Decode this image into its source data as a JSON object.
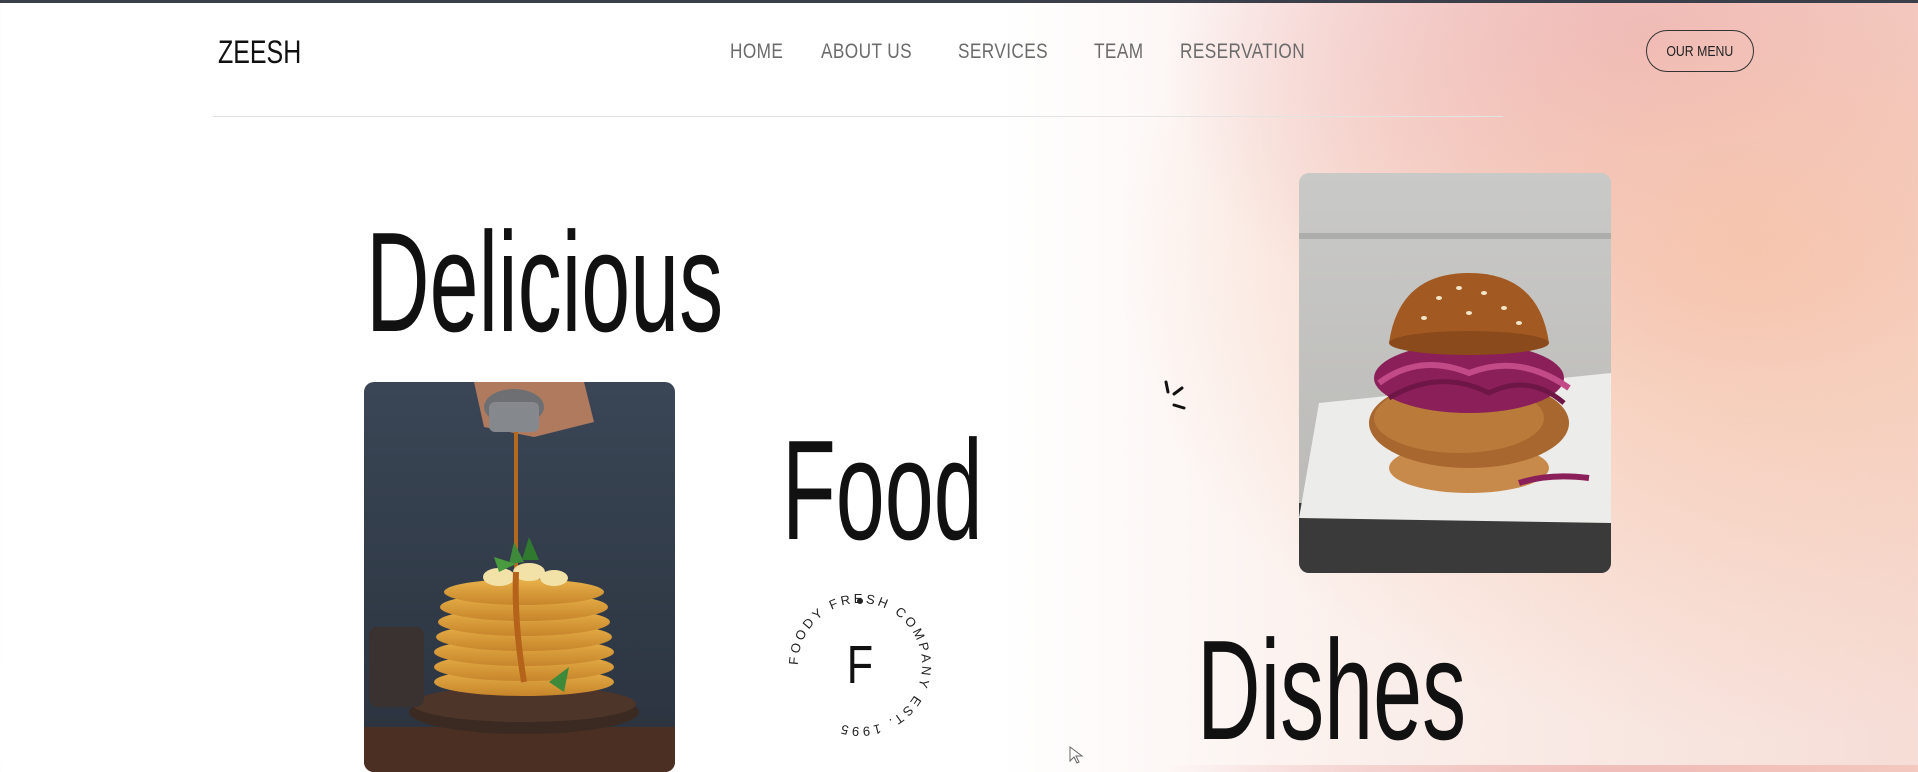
{
  "header": {
    "brand": "ZEESH",
    "nav": [
      "HOME",
      "ABOUT US",
      "SERVICES",
      "TEAM",
      "RESERVATION"
    ],
    "cta_label": "OUR MENU"
  },
  "hero": {
    "words": [
      "Delicious",
      "Food",
      "Dishes"
    ],
    "stamp": {
      "letter": "F",
      "ring_text": "FOODY FRESH COMPANY EST. 1995"
    }
  },
  "colors": {
    "accent_gradient": [
      "#eab0be",
      "#f6c4aa"
    ],
    "text": "#111111",
    "nav_text": "#6b6b6b"
  },
  "icons": [
    "sparkle-icon",
    "cursor-icon"
  ]
}
